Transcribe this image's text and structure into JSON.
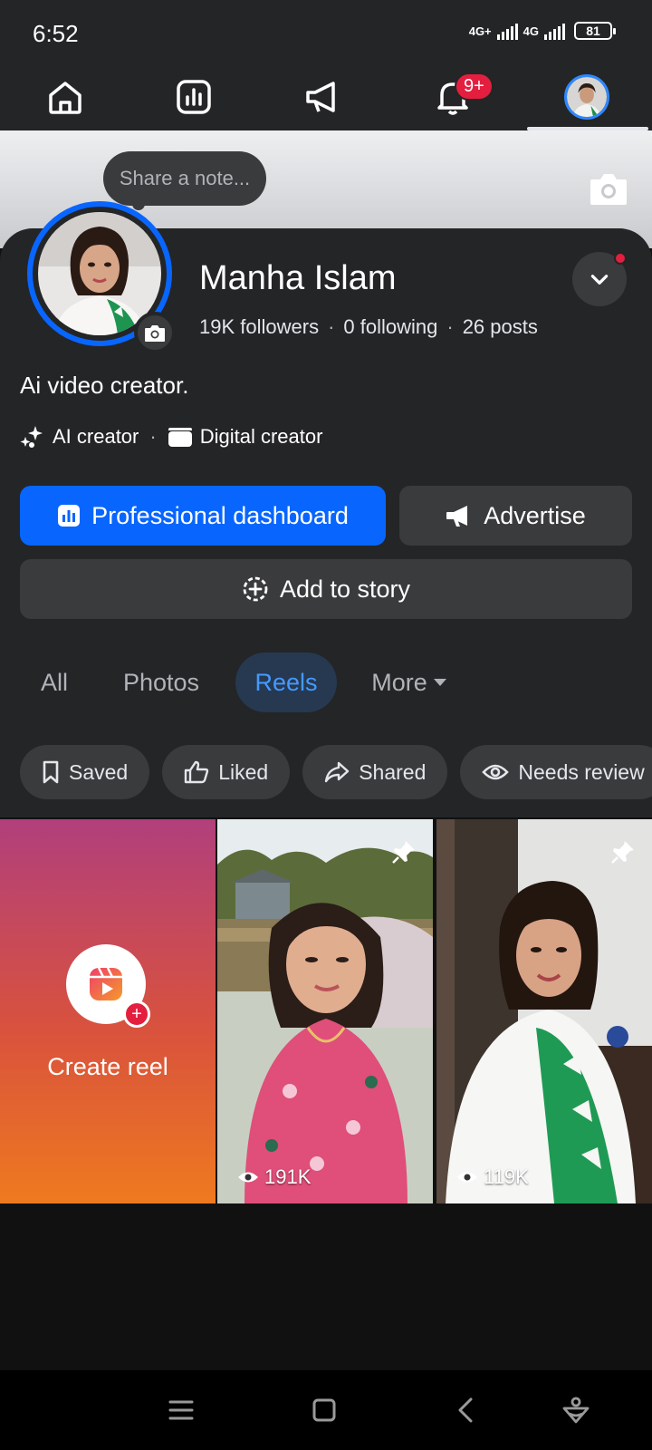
{
  "status_bar": {
    "time": "6:52",
    "network1": "4G+",
    "network2": "4G",
    "battery": "81"
  },
  "top_nav": {
    "items": [
      {
        "icon": "home-icon"
      },
      {
        "icon": "dashboard-icon"
      },
      {
        "icon": "megaphone-icon"
      },
      {
        "icon": "bell-icon",
        "badge": "9+"
      },
      {
        "icon": "profile-avatar",
        "active": true
      }
    ]
  },
  "profile": {
    "note_placeholder": "Share a note...",
    "name": "Manha Islam",
    "followers": "19K followers",
    "following": "0 following",
    "posts": "26 posts",
    "bio": "Ai video creator.",
    "category1": "AI creator",
    "category2": "Digital creator"
  },
  "actions": {
    "dashboard": "Professional dashboard",
    "advertise": "Advertise",
    "add_story": "Add to story"
  },
  "tabs": {
    "all": "All",
    "photos": "Photos",
    "reels": "Reels",
    "more": "More",
    "active": "Reels"
  },
  "chips": {
    "saved": "Saved",
    "liked": "Liked",
    "shared": "Shared",
    "needs_review": "Needs review"
  },
  "reels": {
    "create_label": "Create reel",
    "items": [
      {
        "views": "191K",
        "pinned": true
      },
      {
        "views": "119K",
        "pinned": true
      }
    ]
  },
  "colors": {
    "accent": "#0866ff",
    "background": "#242526",
    "badge": "#e41e3f"
  }
}
